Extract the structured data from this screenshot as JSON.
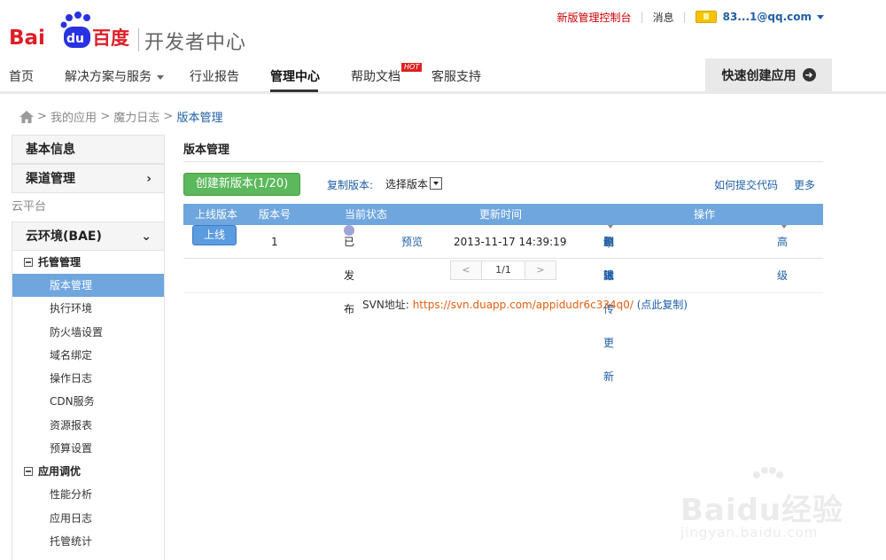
{
  "brand": {
    "logo_text": "开发者中心"
  },
  "topbar": {
    "console_link": "新版管理控制台",
    "messages": "消息",
    "user_email": "83...1@qq.com"
  },
  "nav": {
    "items": [
      "首页",
      "解决方案与服务",
      "行业报告",
      "管理中心",
      "帮助文档",
      "客服支持"
    ],
    "hot_badge": "HOT",
    "quick_create": "快速创建应用"
  },
  "breadcrumb": {
    "items": [
      "我的应用",
      "魔力日志"
    ],
    "current": "版本管理",
    "separator": ">"
  },
  "sidebar": {
    "basic_info": "基本信息",
    "channel_mgmt": "渠道管理",
    "cloud_platform": "云平台",
    "cloud_env": "云环境(BAE)",
    "group_hosting": "托管管理",
    "hosting_items": [
      "版本管理",
      "执行环境",
      "防火墙设置",
      "域名绑定",
      "操作日志",
      "CDN服务",
      "资源报表",
      "预算设置"
    ],
    "group_tuning": "应用调优",
    "tuning_items": [
      "性能分析",
      "应用日志",
      "托管统计"
    ]
  },
  "main": {
    "title": "版本管理",
    "create_button": "创建新版本(1/20)",
    "copy_version_label": "复制版本:",
    "select_value": "选择版本",
    "how_submit_link": "如何提交代码",
    "more_link": "更多",
    "table": {
      "headers": [
        "上线版本",
        "版本号",
        "当前状态",
        "更新时间",
        "操作"
      ],
      "row": {
        "online_button": "上线",
        "version": "1",
        "status": "已发布",
        "preview": "预览",
        "updated": "2013-11-17 14:39:19",
        "ops": [
          "包上传更新",
          "编辑",
          "删除",
          "测试",
          "高级"
        ]
      }
    },
    "pager": {
      "prev": "<",
      "page": "1/1",
      "next": ">"
    },
    "svn": {
      "label": "SVN地址:",
      "url": "https://svn.duapp.com/appidudr6c334q0/",
      "copy": "(点此复制)"
    }
  },
  "watermark": {
    "text": "Baidu经验",
    "sub": "jingyan.baidu.com"
  },
  "colors": {
    "accent_blue": "#6fa6de",
    "create_green": "#5cb85c",
    "brand_red": "#de1e27",
    "brand_blue": "#2932e1"
  }
}
